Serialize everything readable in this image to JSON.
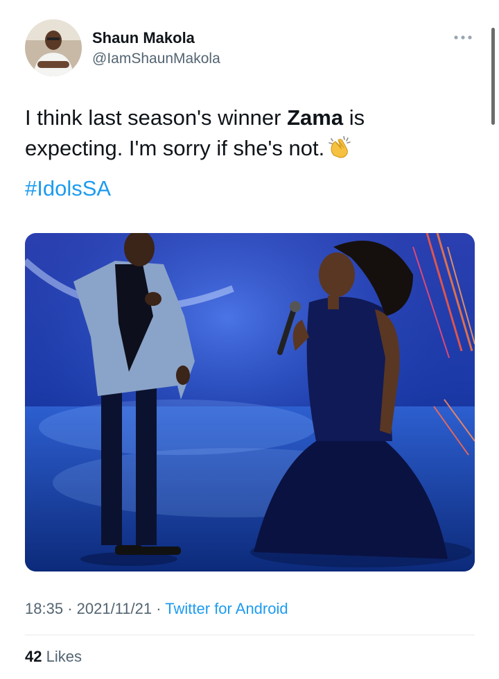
{
  "author": {
    "display_name": "Shaun Makola",
    "handle": "@IamShaunMakola",
    "avatar_icon": "user-avatar"
  },
  "tweet": {
    "text_part1": "I think last season's winner ",
    "text_bold": "Zama",
    "text_part2": " is expecting. I'm sorry if she's not.",
    "emoji": "clapping-hands",
    "hashtag": "#IdolsSA"
  },
  "media": {
    "type": "photo",
    "description_icon": "stage-photo"
  },
  "meta": {
    "time": "18:35",
    "separator": "·",
    "date": "2021/11/21",
    "source": "Twitter for Android"
  },
  "stats": {
    "likes_count": "42",
    "likes_label": "Likes"
  },
  "colors": {
    "link": "#1d9bf0",
    "secondary_text": "#536471",
    "primary_text": "#0f1419"
  }
}
